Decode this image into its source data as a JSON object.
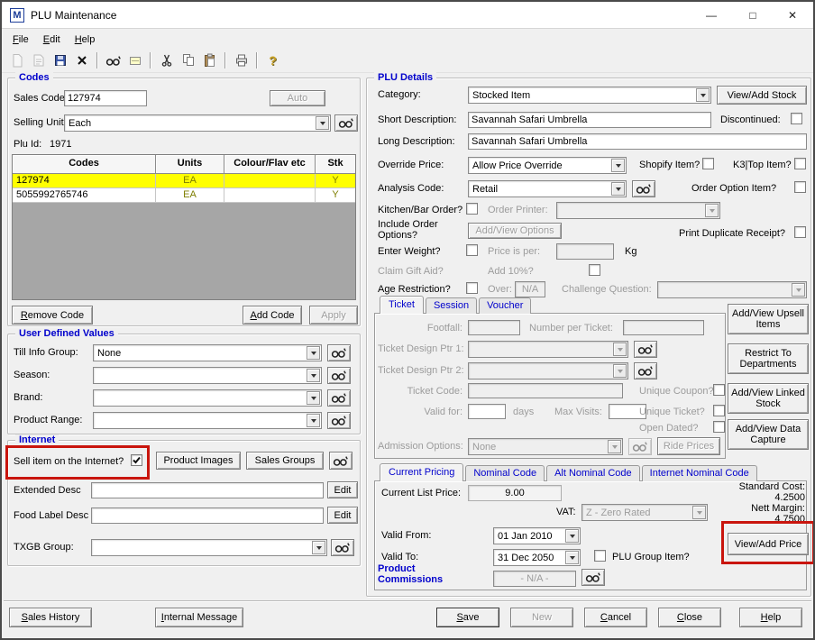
{
  "window": {
    "title": "PLU Maintenance",
    "app_icon_letter": "M",
    "controls": {
      "minimize": "—",
      "maximize": "□",
      "close": "✕"
    },
    "menu": {
      "file": "File",
      "edit": "Edit",
      "help": "Help"
    },
    "toolbar_icons": [
      "new-document",
      "open-document",
      "save",
      "delete",
      "find-binoculars",
      "price-label",
      "cut",
      "copy",
      "paste",
      "print",
      "help"
    ],
    "help_icon_glyph": "?"
  },
  "codes": {
    "legend": "Codes",
    "sales_code": {
      "label": "Sales Code:",
      "value": "127974"
    },
    "auto_button": "Auto",
    "selling_unit": {
      "label": "Selling Unit:",
      "value": "Each"
    },
    "plu_id": {
      "label": "Plu Id:",
      "value": "1971"
    },
    "table": {
      "headers": [
        "Codes",
        "Units",
        "Colour/Flav etc",
        "Stk"
      ],
      "rows": [
        {
          "code": "127974",
          "units": "EA",
          "colour": "",
          "stk": "Y"
        },
        {
          "code": "5055992765746",
          "units": "EA",
          "colour": "",
          "stk": "Y"
        }
      ]
    },
    "remove_code_button": "Remove Code",
    "add_code_button": "Add Code",
    "apply_button": "Apply"
  },
  "user_defined": {
    "legend": "User Defined Values",
    "till_info": {
      "label": "Till Info Group:",
      "value": "None"
    },
    "season": {
      "label": "Season:",
      "value": ""
    },
    "brand": {
      "label": "Brand:",
      "value": ""
    },
    "product_range": {
      "label": "Product Range:",
      "value": ""
    }
  },
  "internet": {
    "legend": "Internet",
    "sell_online_label": "Sell item on the Internet?",
    "sell_online_checked": true,
    "product_images_button": "Product Images",
    "sales_groups_button": "Sales Groups",
    "extended_desc_label": "Extended Desc",
    "extended_desc_value": "",
    "food_label_desc_label": "Food Label Desc",
    "food_label_desc_value": "",
    "edit_button": "Edit",
    "txgb_group_label": "TXGB Group:",
    "txgb_group_value": ""
  },
  "footer_left": {
    "sales_history_button": "Sales History",
    "internal_message_button": "Internal Message"
  },
  "plu_details": {
    "legend": "PLU Details",
    "category": {
      "label": "Category:",
      "value": "Stocked Item"
    },
    "view_add_stock_button": "View/Add Stock",
    "short_description": {
      "label": "Short Description:",
      "value": "Savannah Safari Umbrella"
    },
    "discontinued_label": "Discontinued:",
    "long_description": {
      "label": "Long Description:",
      "value": "Savannah Safari Umbrella"
    },
    "override_price": {
      "label": "Override Price:",
      "value": "Allow Price Override"
    },
    "shopify_label": "Shopify Item?",
    "k3_top_label": "K3|Top Item?",
    "analysis_code": {
      "label": "Analysis Code:",
      "value": "Retail"
    },
    "order_option_label": "Order Option Item?",
    "kitchen_bar_label": "Kitchen/Bar Order?",
    "order_printer_label": "Order Printer:",
    "include_order_label": "Include Order Options?",
    "add_view_options_button": "Add/View Options",
    "print_duplicate_label": "Print Duplicate Receipt?",
    "enter_weight_label": "Enter Weight?",
    "price_per_label": "Price is per:",
    "kg_label": "Kg",
    "claim_gift_label": "Claim Gift Aid?",
    "add_10_label": "Add 10%?",
    "age_restriction_label": "Age Restriction?",
    "over_label": "Over:",
    "over_value": "N/A",
    "challenge_label": "Challenge Question:"
  },
  "ticket": {
    "tabs": [
      "Ticket",
      "Session",
      "Voucher"
    ],
    "footfall_label": "Footfall:",
    "number_per_ticket_label": "Number per Ticket:",
    "design_ptr1_label": "Ticket Design Ptr 1:",
    "design_ptr2_label": "Ticket Design Ptr 2:",
    "ticket_code_label": "Ticket Code:",
    "unique_coupon_label": "Unique Coupon?",
    "valid_for_label": "Valid for:",
    "days_label": "days",
    "max_visits_label": "Max Visits:",
    "unique_ticket_label": "Unique Ticket?",
    "open_dated_label": "Open Dated?",
    "admission_options": {
      "label": "Admission Options:",
      "value": "None"
    },
    "ride_prices_button": "Ride Prices"
  },
  "side_buttons": {
    "upsell": "Add/View Upsell Items",
    "restrict": "Restrict To Departments",
    "linked_stock": "Add/View Linked Stock",
    "data_capture": "Add/View Data Capture"
  },
  "pricing": {
    "tabs": [
      "Current Pricing",
      "Nominal Code",
      "Alt Nominal Code",
      "Internet Nominal Code"
    ],
    "current_list_price": {
      "label": "Current List Price:",
      "value": "9.00"
    },
    "standard_cost": {
      "label": "Standard Cost:",
      "value": "4.2500"
    },
    "vat": {
      "label": "VAT:",
      "value": "Z - Zero Rated"
    },
    "nett_margin": {
      "label": "Nett Margin:",
      "value": "4.7500"
    },
    "valid_from": {
      "label": "Valid From:",
      "value": "01 Jan 2010"
    },
    "valid_to": {
      "label": "Valid To:",
      "value": "31 Dec 2050"
    },
    "plu_group_label": "PLU Group Item?",
    "view_add_price_button": "View/Add Price",
    "product_commissions_label": "Product Commissions",
    "commissions_value": "- N/A -"
  },
  "footer_buttons": {
    "save": "Save",
    "new": "New",
    "cancel": "Cancel",
    "close": "Close",
    "help": "Help"
  },
  "colors": {
    "legend_blue": "#0000cc",
    "selected_row_yellow": "#ffff00",
    "grid_text_olive": "#7e7e00",
    "annotation_red": "#c9150d"
  }
}
